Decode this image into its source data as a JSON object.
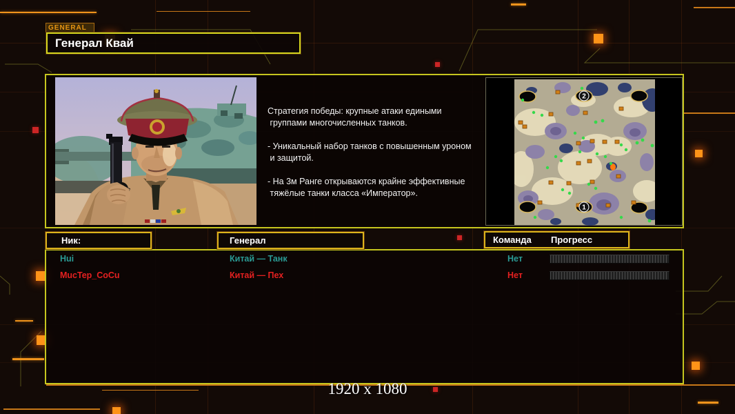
{
  "badge": {
    "label": "GENERAL"
  },
  "header": {
    "title": "Генерал Квай"
  },
  "general_info": {
    "description": "Стратегия победы: крупные атаки едиными\n группами многочисленных танков.\n\n- Уникальный набор танков с повышенным уроном\n и защитой.\n\n- На 3м Ранге открываются крайне эффективные\n тяжёлые танки класса «Император»."
  },
  "minimap": {
    "start_marker_top": "2",
    "start_marker_bottom": "1"
  },
  "table": {
    "columns": {
      "nick": "Ник:",
      "general": "Генерал",
      "team": "Команда",
      "progress": "Прогресс"
    },
    "players": [
      {
        "nick": "Hui",
        "general": "Китай — Танк",
        "team": "Нет",
        "color": "#2a9a94",
        "progress_percent": 0
      },
      {
        "nick": "MucTep_CoCu",
        "general": "Китай — Пех",
        "team": "Нет",
        "color": "#e32020",
        "progress_percent": 0
      }
    ]
  },
  "footer": {
    "resolution": "1920 x 1080"
  },
  "colors": {
    "panel_border": "#c6c61e",
    "header_border": "#dcb41c",
    "accent_orange": "#ff8c14",
    "teal_player": "#2a9a94",
    "red_player": "#e32020"
  }
}
